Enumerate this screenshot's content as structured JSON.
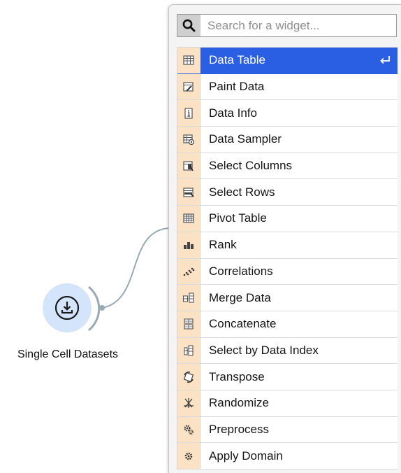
{
  "canvas": {
    "node": {
      "label": "Single Cell Datasets",
      "icon": "download-icon",
      "color": "#d3e4fb"
    }
  },
  "menu": {
    "search": {
      "placeholder": "Search for a widget...",
      "value": "",
      "icon": "search-icon"
    },
    "selected_color": "#2b5fe3",
    "icon_bg_color": "#fbe2c4",
    "items": [
      {
        "label": "Data Table",
        "icon": "data-table-icon",
        "selected": true,
        "shortcut_icon": "enter-key-icon"
      },
      {
        "label": "Paint Data",
        "icon": "paint-data-icon"
      },
      {
        "label": "Data Info",
        "icon": "data-info-icon"
      },
      {
        "label": "Data Sampler",
        "icon": "data-sampler-icon"
      },
      {
        "label": "Select Columns",
        "icon": "select-columns-icon"
      },
      {
        "label": "Select Rows",
        "icon": "select-rows-icon"
      },
      {
        "label": "Pivot Table",
        "icon": "pivot-table-icon"
      },
      {
        "label": "Rank",
        "icon": "rank-icon"
      },
      {
        "label": "Correlations",
        "icon": "correlations-icon"
      },
      {
        "label": "Merge Data",
        "icon": "merge-data-icon"
      },
      {
        "label": "Concatenate",
        "icon": "concatenate-icon"
      },
      {
        "label": "Select by Data Index",
        "icon": "select-by-data-index-icon"
      },
      {
        "label": "Transpose",
        "icon": "transpose-icon"
      },
      {
        "label": "Randomize",
        "icon": "randomize-icon"
      },
      {
        "label": "Preprocess",
        "icon": "preprocess-icon"
      },
      {
        "label": "Apply Domain",
        "icon": "apply-domain-icon"
      }
    ]
  }
}
